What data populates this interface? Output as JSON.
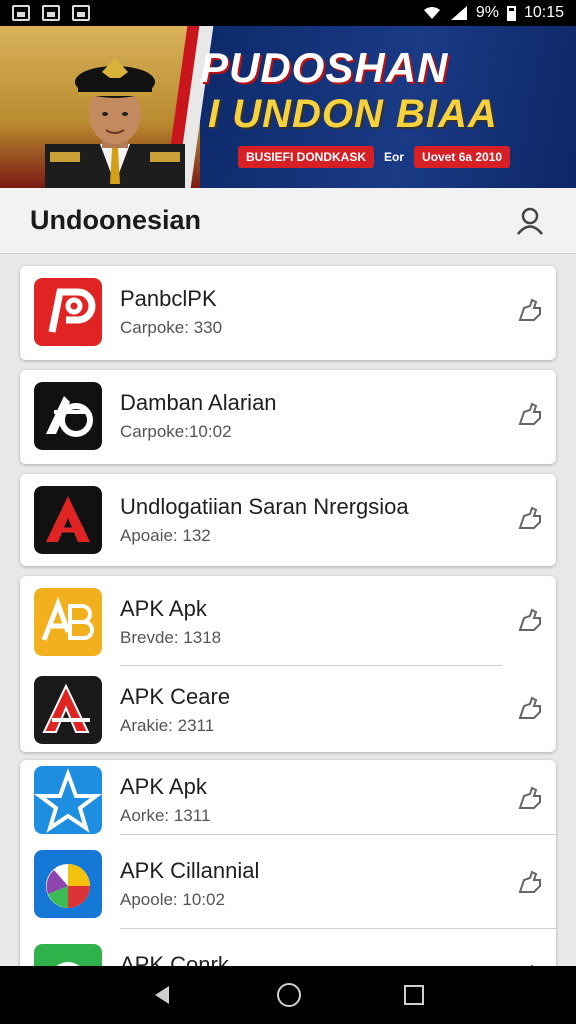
{
  "status_bar": {
    "battery": "9%",
    "time": "10:15"
  },
  "banner": {
    "headline_1": "PUDOSHAN",
    "headline_2": "I UNDON BIAA",
    "tag_left": "BUSIEFI DONDKASK",
    "tag_mid": "Eor",
    "tag_right": "Uovet 6a 2010"
  },
  "appbar": {
    "title": "Undoonesian"
  },
  "apps": [
    {
      "name": "PanbclPK",
      "meta": "Carpoke: 330",
      "icon": "red-p-logo-icon"
    },
    {
      "name": "Damban Alarian",
      "meta": "Carpoke:10:02",
      "icon": "black-swirl-logo-icon"
    },
    {
      "name": "Undlogatiian Saran Nrergsioa",
      "meta": "Apoaie: 132",
      "icon": "black-red-a-logo-icon"
    },
    {
      "name": "APK  Apk",
      "meta": "Brevde: 1318",
      "icon": "yellow-ab-logo-icon"
    },
    {
      "name": "APK Ceare",
      "meta": "Arakie: 2311",
      "icon": "black-red-a-logo-icon"
    },
    {
      "name": "APK Apk",
      "meta": "Aorke: 1311",
      "icon": "blue-star-logo-icon"
    },
    {
      "name": "APK Cillannial",
      "meta": "Apoole: 10:02",
      "icon": "blue-gradient-logo-icon"
    },
    {
      "name": "APK Conrk",
      "meta": "",
      "icon": "green-logo-icon"
    }
  ],
  "colors": {
    "banner_red": "#c41e22",
    "banner_blue": "#0d2a6b",
    "headline_yellow": "#f7d23c"
  }
}
